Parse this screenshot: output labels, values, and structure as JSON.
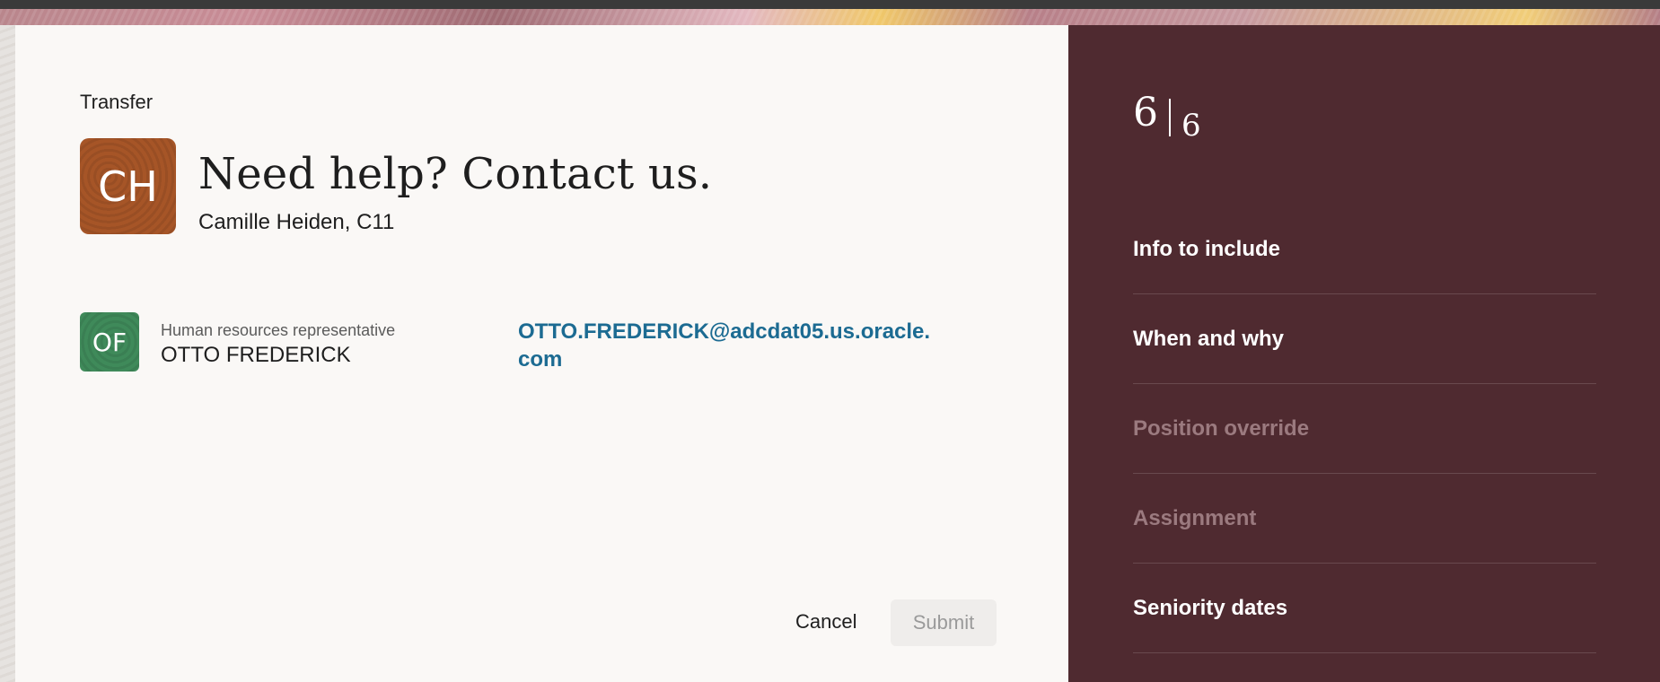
{
  "flow": {
    "title": "Transfer"
  },
  "header": {
    "avatar_initials": "CH",
    "heading": "Need help? Contact us.",
    "subject": "Camille Heiden, C11"
  },
  "contact": {
    "avatar_initials": "OF",
    "role": "Human resources representative",
    "name": "OTTO FREDERICK",
    "email": "OTTO.FREDERICK@adcdat05.us.oracle.com"
  },
  "actions": {
    "cancel_label": "Cancel",
    "submit_label": "Submit"
  },
  "progress": {
    "current": "6",
    "total": "6"
  },
  "steps": [
    {
      "label": "Info to include",
      "enabled": true
    },
    {
      "label": "When and why",
      "enabled": true
    },
    {
      "label": "Position override",
      "enabled": false
    },
    {
      "label": "Assignment",
      "enabled": false
    },
    {
      "label": "Seniority dates",
      "enabled": true
    }
  ],
  "colors": {
    "side_panel": "#4f2a30",
    "link": "#1c6b92",
    "avatar_ch": "#a65527",
    "avatar_of": "#3f8a5a"
  }
}
